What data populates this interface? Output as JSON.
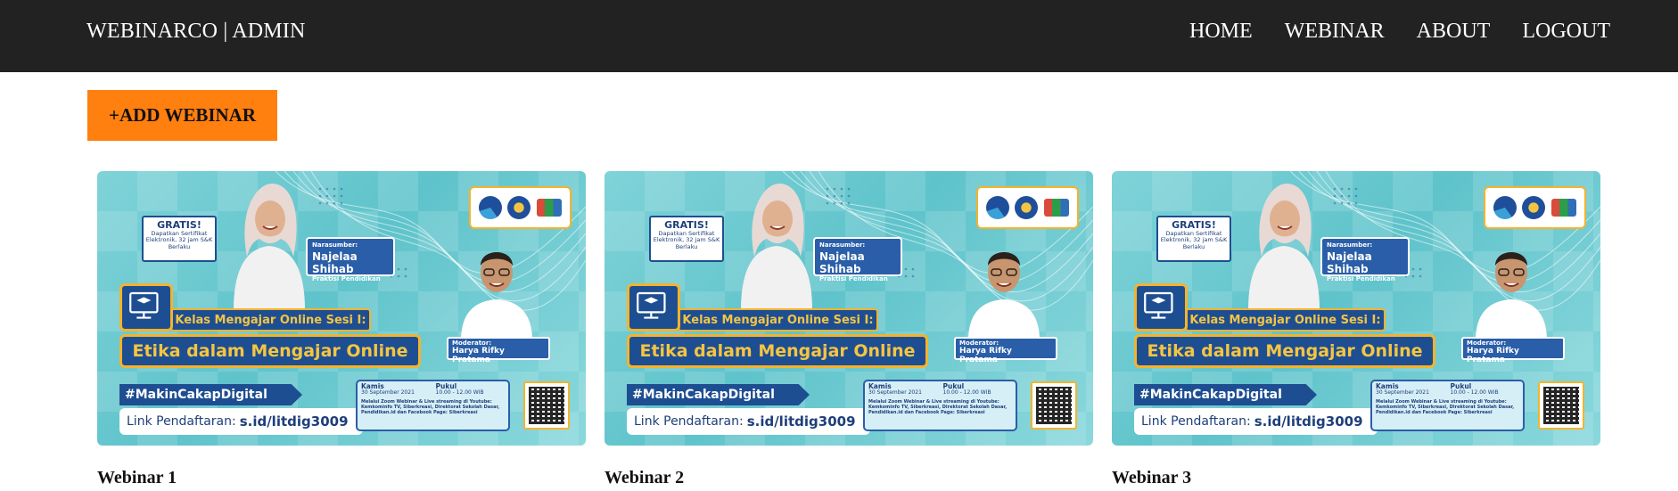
{
  "navbar": {
    "brand": "WEBINARCO | ADMIN",
    "links": [
      "HOME",
      "WEBINAR",
      "ABOUT",
      "LOGOUT"
    ]
  },
  "actions": {
    "add_label": "+ADD WEBINAR"
  },
  "colors": {
    "navbar_bg": "#222222",
    "add_button": "#ff7f0f",
    "poster_teal": "#6cc9cf",
    "poster_navy": "#1e4e92",
    "poster_gold": "#f5b32b"
  },
  "poster": {
    "gratis": "GRATIS!",
    "gratis_note": "Dapatkan Sertifikat Elektronik, 32 jam S&K Berlaku",
    "narasumber_label": "Narasumber:",
    "narasumber_name": "Najelaa Shihab",
    "narasumber_role": "Praktisi Pendidikan",
    "sesi": "Kelas Mengajar Online Sesi I:",
    "topic": "Etika dalam Mengajar Online",
    "moderator_label": "Moderator:",
    "moderator_name": "Harya Rifky Pratama",
    "hashtag": "#MakinCakapDigital",
    "link_label": "Link Pendaftaran:",
    "link_url": "s.id/litdig3009",
    "day": "Kamis",
    "date": "30 September 2021",
    "time_label": "Pukul",
    "time": "10.00 - 12.00 WIB",
    "description": "Melalui Zoom Webinar & Live streaming di Youtube: Kemkominfo TV, Siberkreasi, Direktorat Sekolah Dasar, Pendidikan.id dan Facebook Page: Siberkreasi",
    "logos": [
      "kominfo-logo",
      "kemdikbud-logo",
      "siberkreasi-logo"
    ]
  },
  "webinars": [
    {
      "title": "Webinar 1"
    },
    {
      "title": "Webinar 2"
    },
    {
      "title": "Webinar 3"
    }
  ]
}
